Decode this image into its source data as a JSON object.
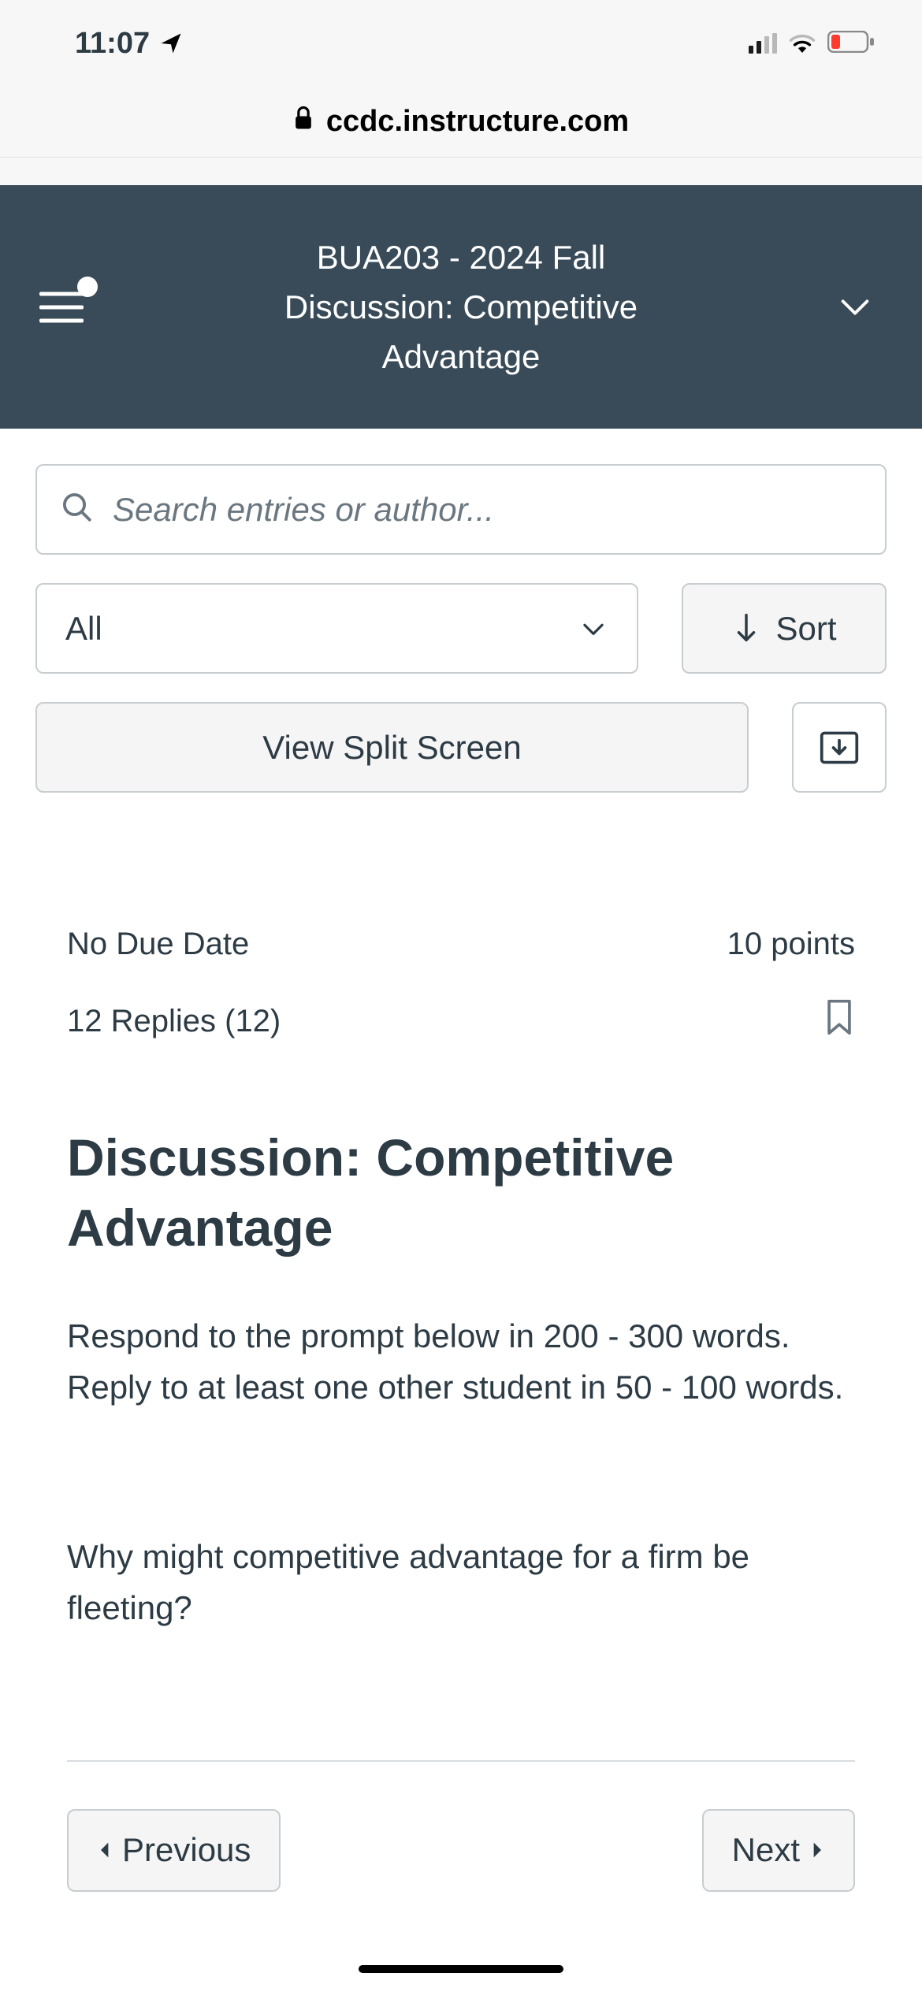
{
  "status_bar": {
    "time": "11:07"
  },
  "browser": {
    "url": "ccdc.instructure.com"
  },
  "header": {
    "line1": "BUA203 - 2024 Fall",
    "line2": "Discussion: Competitive",
    "line3": "Advantage"
  },
  "tools": {
    "search_placeholder": "Search entries or author...",
    "filter_label": "All",
    "sort_label": "Sort",
    "split_label": "View Split Screen"
  },
  "content": {
    "due": "No Due Date",
    "points": "10 points",
    "replies": "12 Replies (12)",
    "title": "Discussion: Competitive Advantage",
    "p1": "Respond to the prompt below in 200 - 300 words. Reply to at least one other student in 50 - 100 words.",
    "p2": "Why might competitive advantage for a firm be fleeting?"
  },
  "nav": {
    "prev": "Previous",
    "next": "Next"
  }
}
